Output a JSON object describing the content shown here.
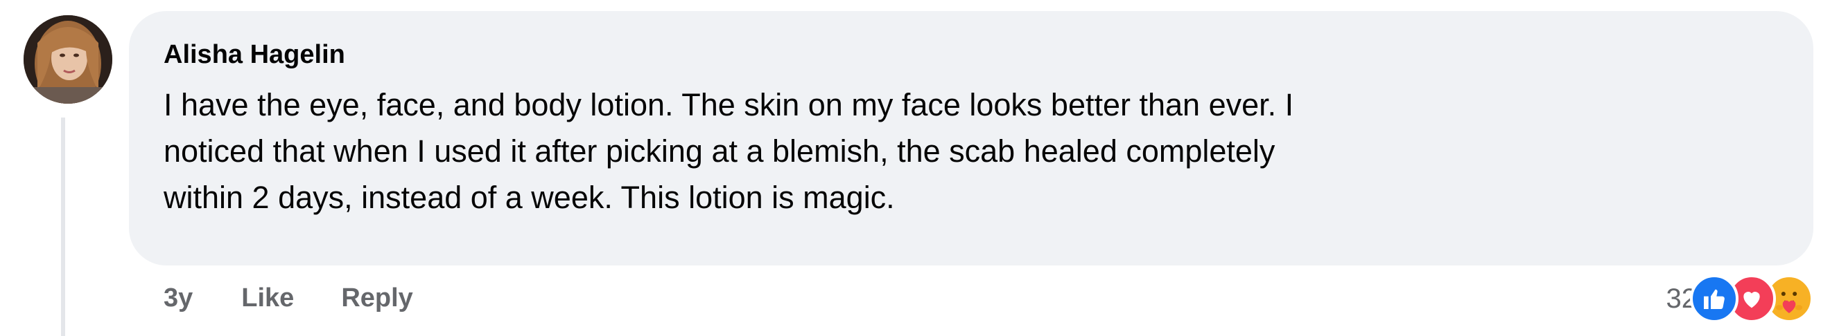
{
  "comment": {
    "author": "Alisha Hagelin",
    "body_lines": [
      "I have the eye, face, and body lotion. The skin on my face looks better than ever. I",
      "noticed that when I used it after picking at a blemish, the scab healed completely",
      "within 2 days, instead of a week. This lotion is magic."
    ]
  },
  "actions": {
    "time": "3y",
    "like_label": "Like",
    "reply_label": "Reply"
  },
  "reactions": {
    "count": "32",
    "types": [
      "like-icon",
      "love-icon",
      "care-icon"
    ]
  },
  "colors": {
    "bubble": "#f0f2f5",
    "text": "#050505",
    "secondary": "#65676b",
    "like_blue": "#1877f2",
    "love_red": "#f33e58",
    "care_yellow": "#f7b125"
  }
}
